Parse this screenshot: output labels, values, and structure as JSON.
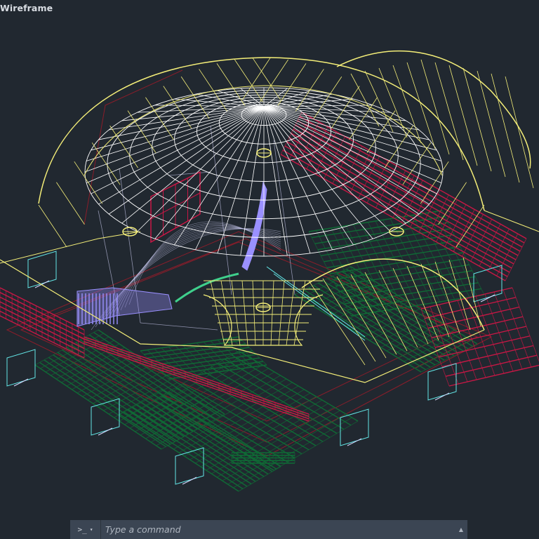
{
  "viewport": {
    "style_label": "Wireframe",
    "background": "#212830",
    "colors": {
      "roof": "#f4ee78",
      "dome_grid": "#ffffff",
      "seating_green": "#0f6b35",
      "seating_red": "#c81745",
      "outline_red": "#8a1d2a",
      "stair_blue": "#9a90ff",
      "cyan": "#63e6e6",
      "wall_lines": "#d8d8ff",
      "accent_green": "#3fd08c"
    }
  },
  "command_line": {
    "prompt_icon": ">_",
    "prompt_menu_icon": "▾",
    "placeholder": "Type a command",
    "history_icon": "▲"
  }
}
